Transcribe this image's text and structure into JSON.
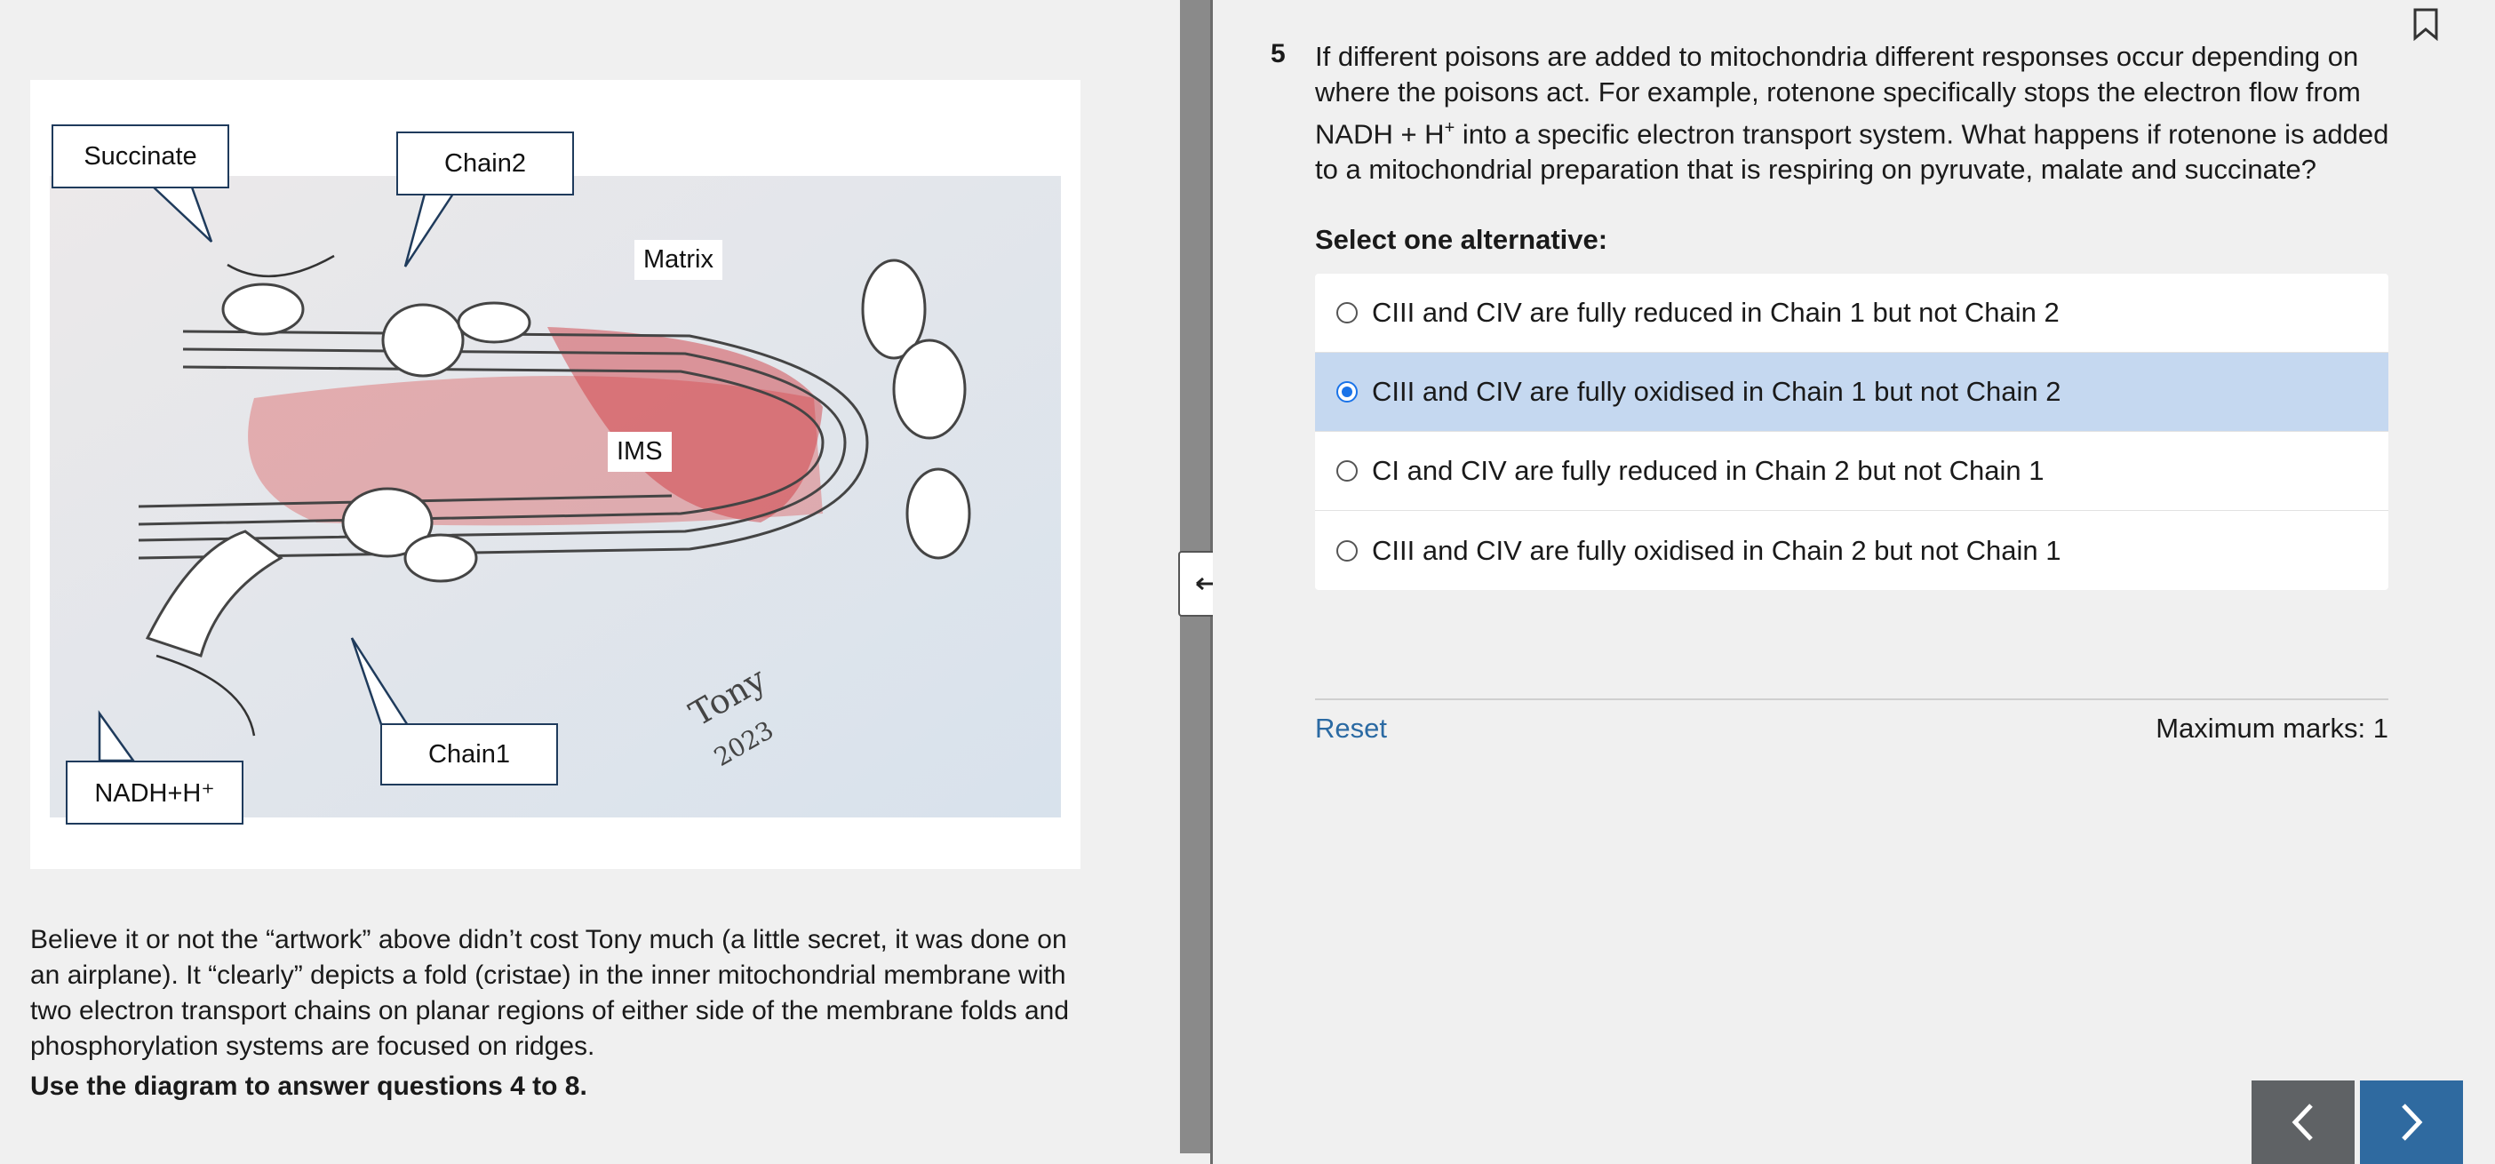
{
  "figure": {
    "labels": {
      "succinate": "Succinate",
      "chain2": "Chain2",
      "matrix": "Matrix",
      "ims": "IMS",
      "chain1": "Chain1",
      "nadh": "NADH+H⁺",
      "signature_name": "Tony",
      "signature_year": "2023"
    }
  },
  "description": {
    "text": "Believe it or not the “artwork” above didn’t cost Tony much (a little secret, it was done on an airplane). It “clearly” depicts a fold (cristae) in the inner mitochondrial membrane with two electron transport chains on planar regions of either side of the membrane folds and phosphorylation systems are focused on ridges.",
    "instruction": "Use the diagram to answer questions 4 to 8."
  },
  "divider": {
    "handle_icon": "resize-horizontal-icon"
  },
  "question": {
    "number": "5",
    "text_part1": "If different poisons are added to mitochondria different responses occur depending on where the poisons act. For example, rotenone specifically stops the electron flow from NADH + H",
    "text_sup": "+",
    "text_part2": " into a specific electron transport system. What happens if rotenone is added to a mitochondrial preparation that is respiring on pyruvate, malate and succinate?",
    "instruction": "Select one alternative:",
    "options": [
      {
        "label": "CIII and CIV are fully reduced in Chain 1 but not Chain 2",
        "selected": false
      },
      {
        "label": "CIII and CIV are fully oxidised in Chain 1 but not Chain 2",
        "selected": true
      },
      {
        "label": "CI and CIV are fully reduced in Chain 2 but not Chain 1",
        "selected": false
      },
      {
        "label": "CIII and CIV are fully oxidised in Chain 2 but not Chain 1",
        "selected": false
      }
    ],
    "reset_label": "Reset",
    "max_marks": "Maximum marks: 1"
  },
  "nav": {
    "prev_icon": "chevron-left-icon",
    "next_icon": "chevron-right-icon",
    "bookmark_icon": "bookmark-icon"
  },
  "colors": {
    "selected": "#c5d8f0",
    "accent": "#2f6aa0",
    "link": "#2b6aa3"
  }
}
